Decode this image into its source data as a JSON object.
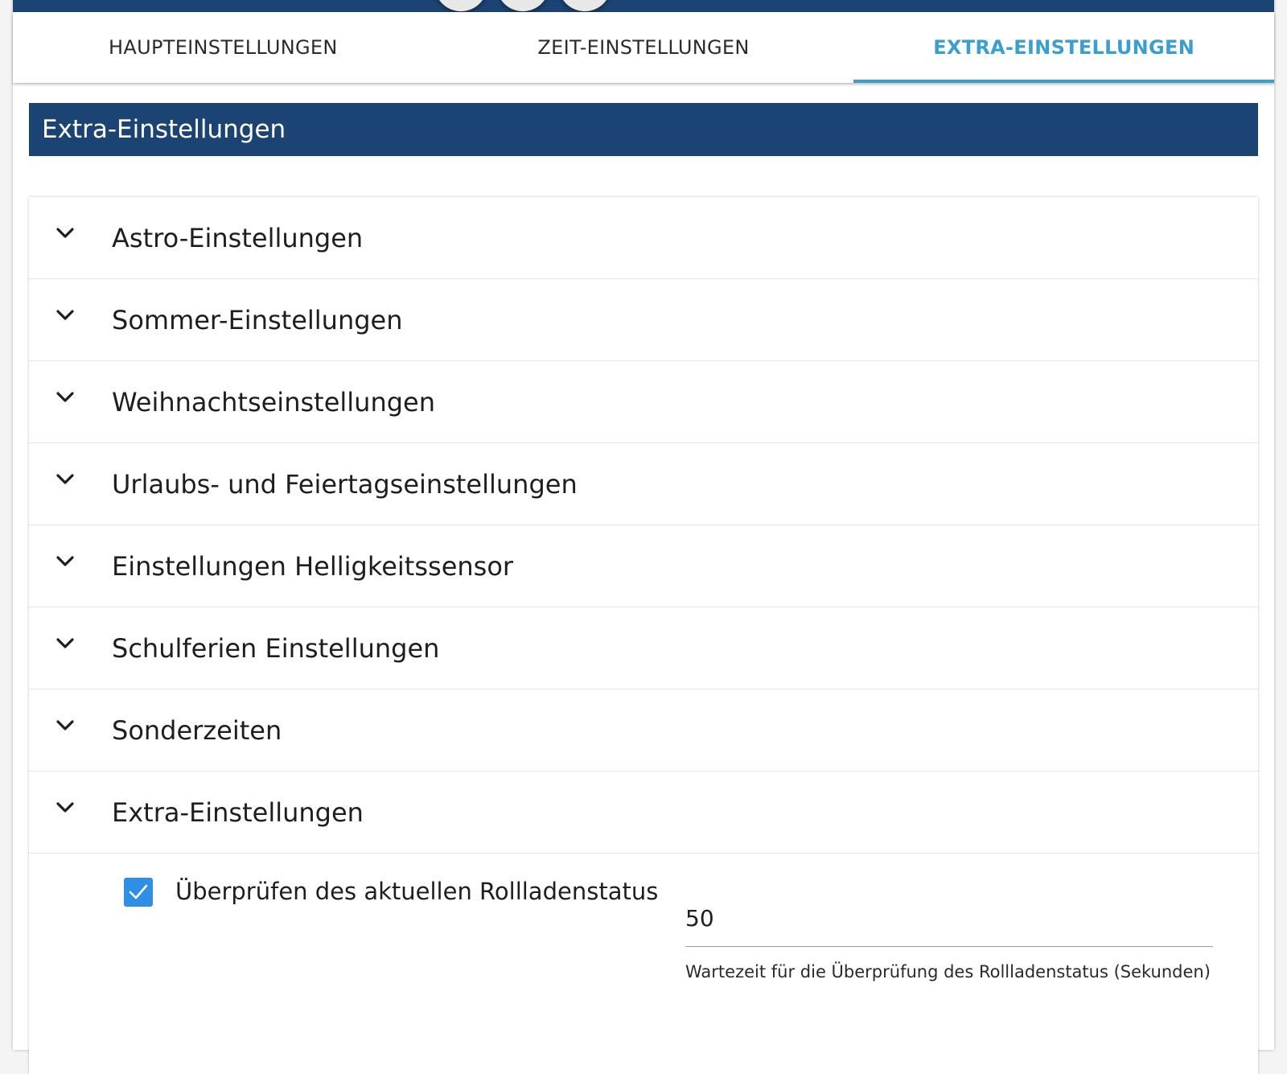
{
  "tabs": [
    {
      "label": "HAUPTEINSTELLUNGEN",
      "active": false
    },
    {
      "label": "ZEIT-EINSTELLUNGEN",
      "active": false
    },
    {
      "label": "EXTRA-EINSTELLUNGEN",
      "active": true
    }
  ],
  "section_title": "Extra-Einstellungen",
  "accordion": {
    "items": [
      {
        "label": "Astro-Einstellungen"
      },
      {
        "label": "Sommer-Einstellungen"
      },
      {
        "label": "Weihnachtseinstellungen"
      },
      {
        "label": "Urlaubs- und Feiertagseinstellungen"
      },
      {
        "label": "Einstellungen Helligkeitssensor"
      },
      {
        "label": "Schulferien Einstellungen"
      },
      {
        "label": "Sonderzeiten"
      },
      {
        "label": "Extra-Einstellungen"
      }
    ],
    "expanded": {
      "checkbox_label": "Überprüfen des aktuellen Rollladenstatus",
      "checkbox_checked": true,
      "wait_value": "50",
      "wait_helper": "Wartezeit für die Überprüfung des Rollladenstatus (Sekunden)"
    }
  },
  "colors": {
    "primary": "#1b4474",
    "accent": "#3a9fcf",
    "checkbox": "#2f8fe6"
  }
}
